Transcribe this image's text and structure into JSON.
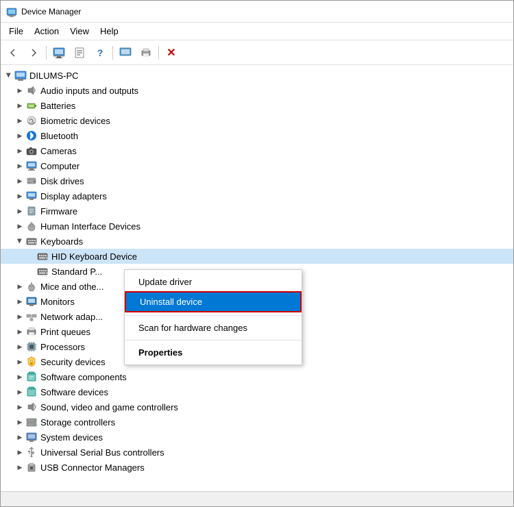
{
  "window": {
    "title": "Device Manager",
    "icon": "💻"
  },
  "menubar": {
    "items": [
      "File",
      "Action",
      "View",
      "Help"
    ]
  },
  "toolbar": {
    "buttons": [
      "←",
      "→",
      "🖥",
      "📋",
      "❓",
      "🖼",
      "🖨",
      "🔌",
      "❌"
    ]
  },
  "tree": {
    "root": "DILUMS-PC",
    "items": [
      {
        "id": "audio",
        "label": "Audio inputs and outputs",
        "indent": 1,
        "icon": "🔊",
        "expanded": false
      },
      {
        "id": "batteries",
        "label": "Batteries",
        "indent": 1,
        "icon": "🔋",
        "expanded": false
      },
      {
        "id": "biometric",
        "label": "Biometric devices",
        "indent": 1,
        "icon": "👁",
        "expanded": false
      },
      {
        "id": "bluetooth",
        "label": "Bluetooth",
        "indent": 1,
        "icon": "🔵",
        "expanded": false
      },
      {
        "id": "cameras",
        "label": "Cameras",
        "indent": 1,
        "icon": "📷",
        "expanded": false
      },
      {
        "id": "computer",
        "label": "Computer",
        "indent": 1,
        "icon": "💻",
        "expanded": false
      },
      {
        "id": "diskdrives",
        "label": "Disk drives",
        "indent": 1,
        "icon": "💾",
        "expanded": false
      },
      {
        "id": "display",
        "label": "Display adapters",
        "indent": 1,
        "icon": "🖥",
        "expanded": false
      },
      {
        "id": "firmware",
        "label": "Firmware",
        "indent": 1,
        "icon": "📦",
        "expanded": false
      },
      {
        "id": "hid",
        "label": "Human Interface Devices",
        "indent": 1,
        "icon": "🖱",
        "expanded": false
      },
      {
        "id": "keyboards",
        "label": "Keyboards",
        "indent": 1,
        "icon": "⌨",
        "expanded": true
      },
      {
        "id": "hid-keyboard",
        "label": "HID Keyboard Device",
        "indent": 2,
        "icon": "⌨",
        "expanded": false,
        "selected": true
      },
      {
        "id": "standard-kb",
        "label": "Standard P...",
        "indent": 2,
        "icon": "⌨",
        "expanded": false
      },
      {
        "id": "mice",
        "label": "Mice and othe...",
        "indent": 1,
        "icon": "🖱",
        "expanded": false
      },
      {
        "id": "monitors",
        "label": "Monitors",
        "indent": 1,
        "icon": "🖥",
        "expanded": false
      },
      {
        "id": "networkadap",
        "label": "Network adap...",
        "indent": 1,
        "icon": "🌐",
        "expanded": false
      },
      {
        "id": "printqueues",
        "label": "Print queues",
        "indent": 1,
        "icon": "🖨",
        "expanded": false
      },
      {
        "id": "processors",
        "label": "Processors",
        "indent": 1,
        "icon": "⚙",
        "expanded": false
      },
      {
        "id": "security",
        "label": "Security devices",
        "indent": 1,
        "icon": "🔐",
        "expanded": false
      },
      {
        "id": "softwarecomp",
        "label": "Software components",
        "indent": 1,
        "icon": "📦",
        "expanded": false
      },
      {
        "id": "softwaredev",
        "label": "Software devices",
        "indent": 1,
        "icon": "📦",
        "expanded": false
      },
      {
        "id": "sound",
        "label": "Sound, video and game controllers",
        "indent": 1,
        "icon": "🔊",
        "expanded": false
      },
      {
        "id": "storage",
        "label": "Storage controllers",
        "indent": 1,
        "icon": "💾",
        "expanded": false
      },
      {
        "id": "system",
        "label": "System devices",
        "indent": 1,
        "icon": "🖥",
        "expanded": false
      },
      {
        "id": "usb",
        "label": "Universal Serial Bus controllers",
        "indent": 1,
        "icon": "🔌",
        "expanded": false
      },
      {
        "id": "usbconn",
        "label": "USB Connector Managers",
        "indent": 1,
        "icon": "🔌",
        "expanded": false
      }
    ]
  },
  "context_menu": {
    "items": [
      {
        "id": "update-driver",
        "label": "Update driver",
        "bold": false,
        "active": false
      },
      {
        "id": "uninstall-device",
        "label": "Uninstall device",
        "bold": false,
        "active": true
      },
      {
        "id": "scan-hardware",
        "label": "Scan for hardware changes",
        "bold": false,
        "active": false
      },
      {
        "id": "properties",
        "label": "Properties",
        "bold": true,
        "active": false
      }
    ]
  }
}
